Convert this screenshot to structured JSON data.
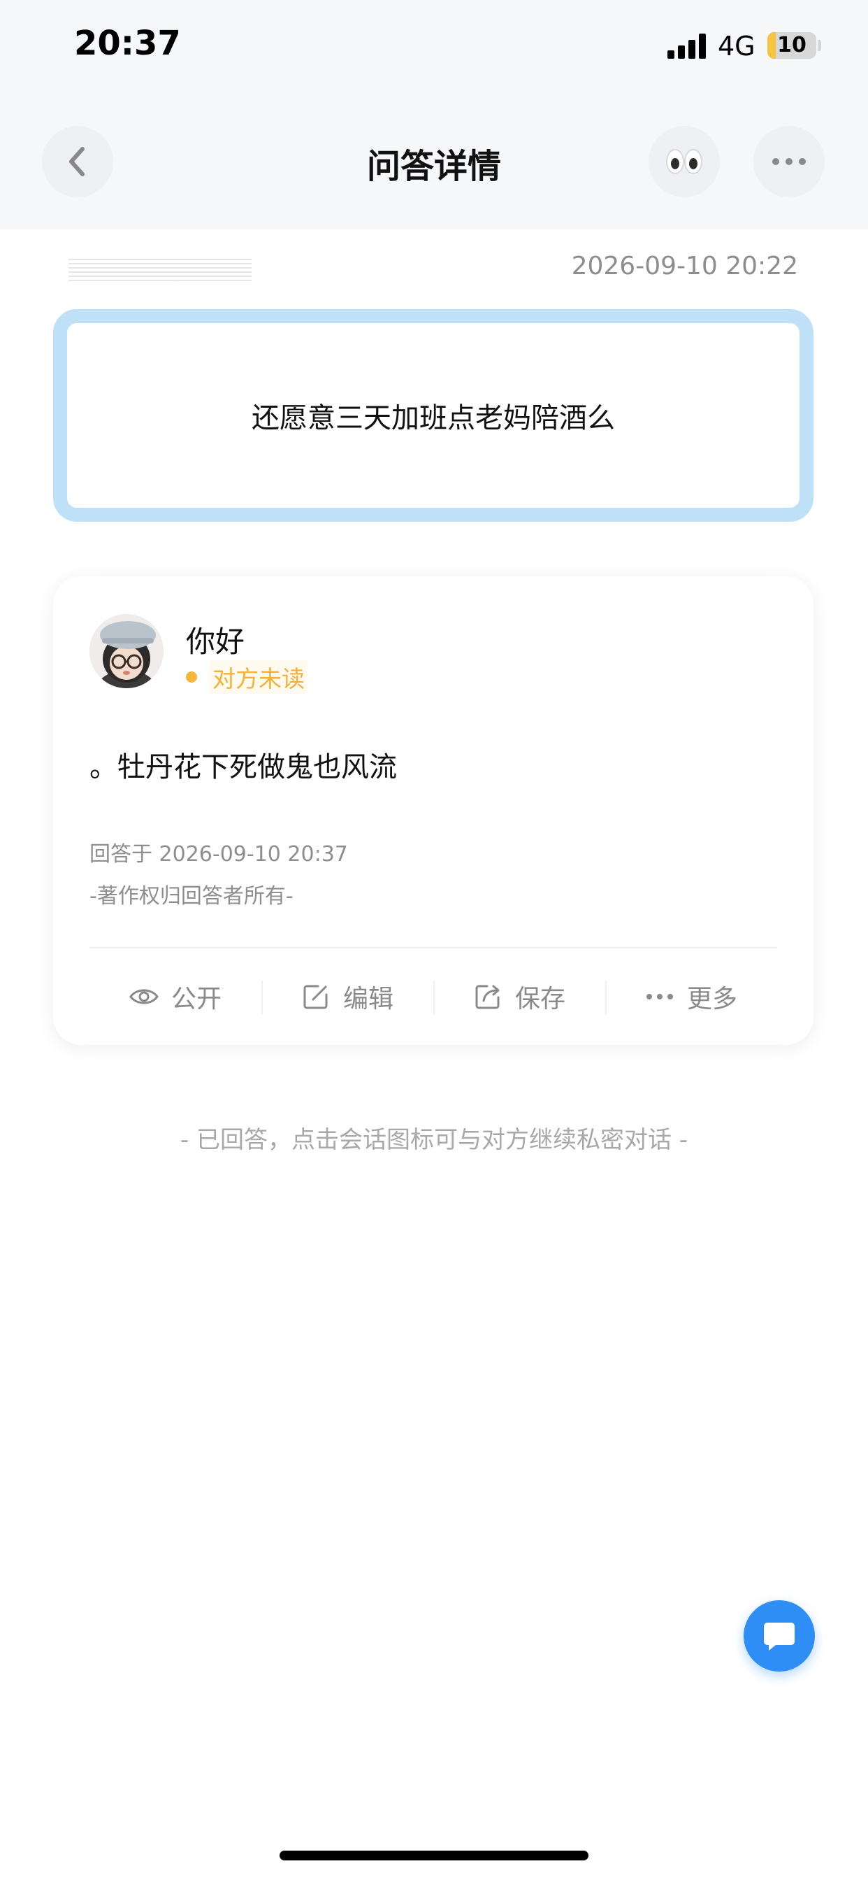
{
  "status_bar": {
    "time": "20:37",
    "network": "4G",
    "battery": "10"
  },
  "nav": {
    "title": "问答详情",
    "back_icon": "chevron-left-icon",
    "eyes_icon": "eyes-emoji-icon",
    "more_icon": "ellipsis-icon"
  },
  "question": {
    "date": "2026-09-10 20:22",
    "text": "还愿意三天加班点老妈陪酒么"
  },
  "answer": {
    "responder_name": "你好",
    "read_status": "对方未读",
    "text": "。牡丹花下死做鬼也风流",
    "answered_time": "回答于 2026-09-10 20:37",
    "copyright": "-著作权归回答者所有-"
  },
  "actions": [
    {
      "label": "公开",
      "icon": "eye-icon"
    },
    {
      "label": "编辑",
      "icon": "edit-icon"
    },
    {
      "label": "保存",
      "icon": "share-export-icon"
    },
    {
      "label": "更多",
      "icon": "more-dots-icon"
    }
  ],
  "footer_hint": "- 已回答，点击会话图标可与对方继续私密对话 -",
  "colors": {
    "accent_blue": "#2f8ef5",
    "question_border": "#bfe1f8",
    "unread_orange": "#f3b135"
  }
}
